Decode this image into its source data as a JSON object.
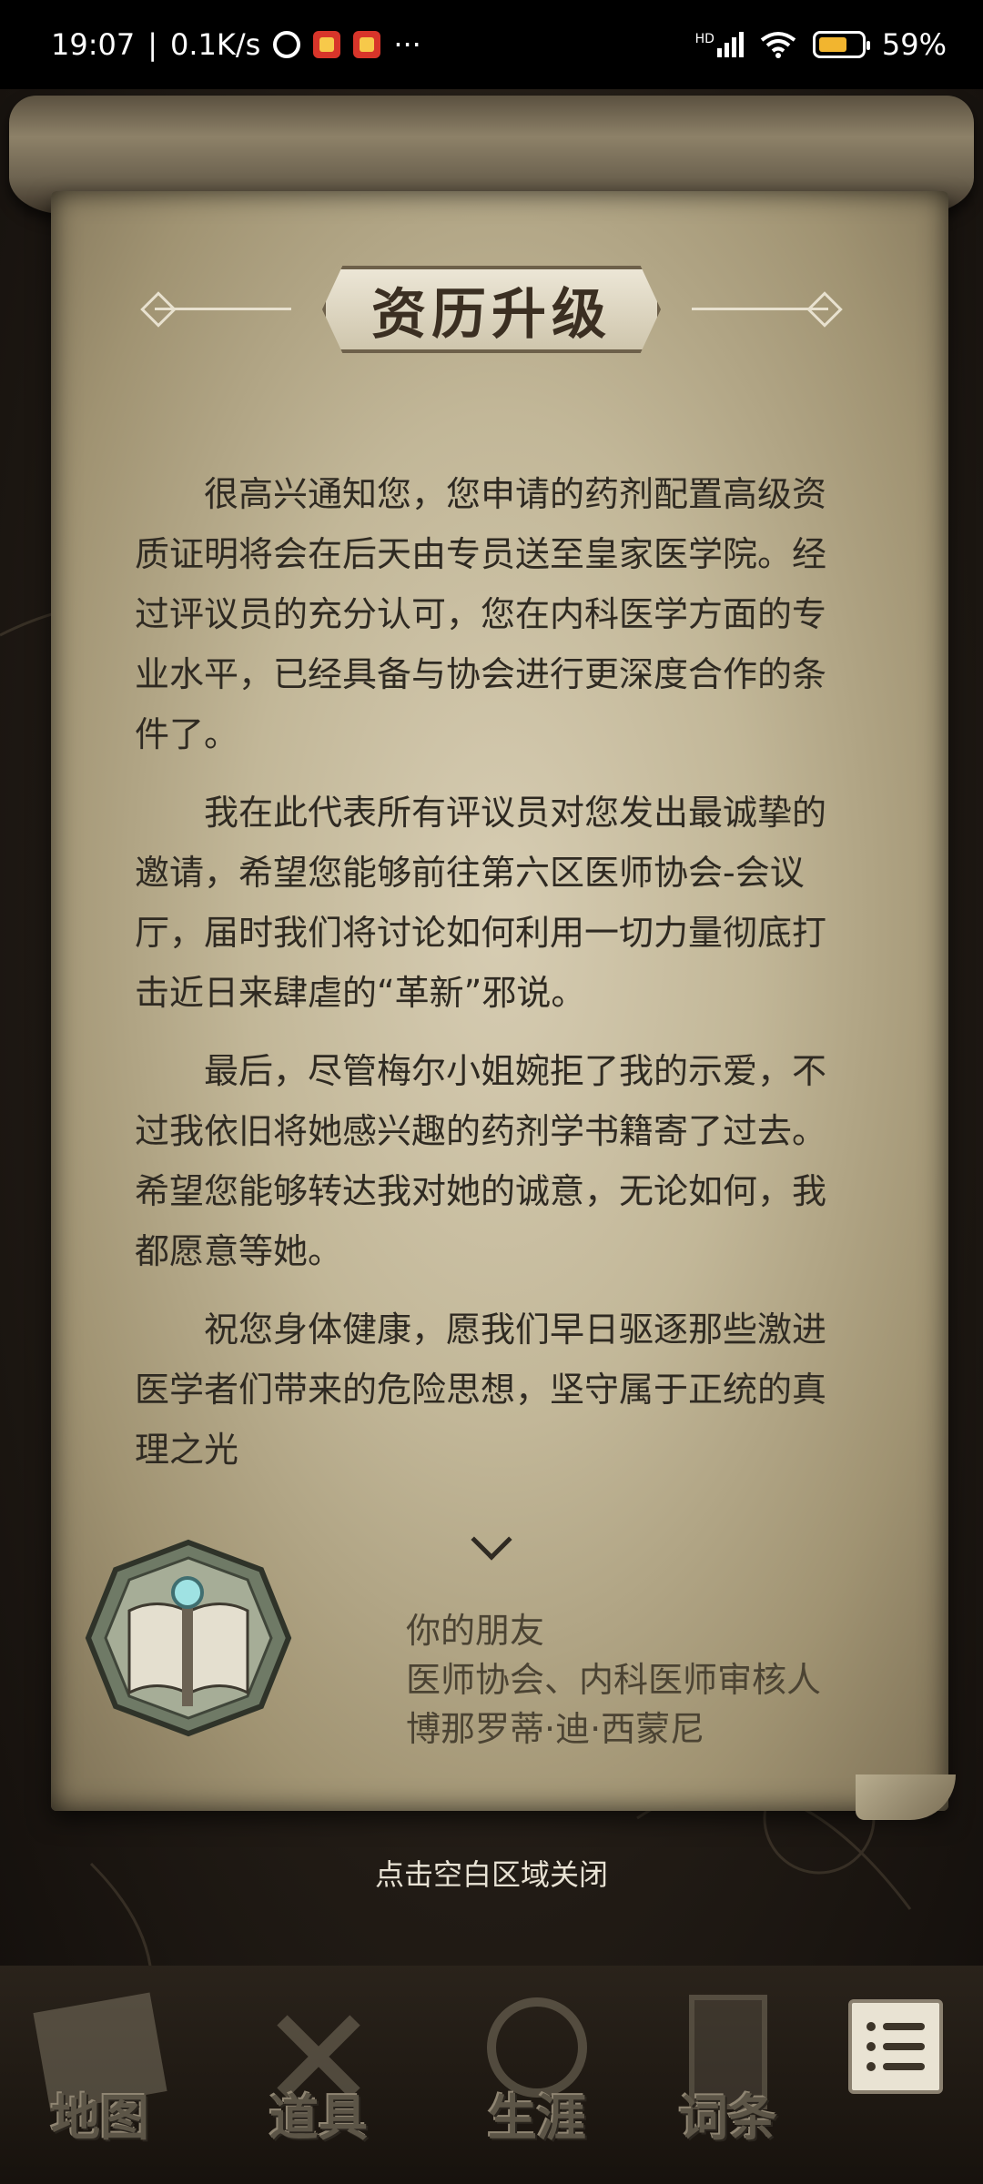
{
  "status_bar": {
    "time": "19:07",
    "speed": "0.1K/s",
    "more": "···",
    "network": "HD",
    "battery": "59%"
  },
  "letter": {
    "title": "资历升级",
    "paragraphs": [
      "很高兴通知您，您申请的药剂配置高级资质证明将会在后天由专员送至皇家医学院。经过评议员的充分认可，您在内科医学方面的专业水平，已经具备与协会进行更深度合作的条件了。",
      "我在此代表所有评议员对您发出最诚挚的邀请，希望您能够前往第六区医师协会-会议厅，届时我们将讨论如何利用一切力量彻底打击近日来肆虐的“革新”邪说。",
      "最后，尽管梅尔小姐婉拒了我的示爱，不过我依旧将她感兴趣的药剂学书籍寄了过去。希望您能够转达我对她的诚意，无论如何，我都愿意等她。",
      "祝您身体健康，愿我们早日驱逐那些激进医学者们带来的危险思想，坚守属于正统的真理之光"
    ],
    "signature": {
      "line1": "你的朋友",
      "line2": "医师协会、内科医师审核人",
      "line3": "博那罗蒂·迪·西蒙尼"
    }
  },
  "close_hint": "点击空白区域关闭",
  "nav": {
    "map": "地图",
    "items": "道具",
    "career": "生涯",
    "terms": "词条"
  }
}
